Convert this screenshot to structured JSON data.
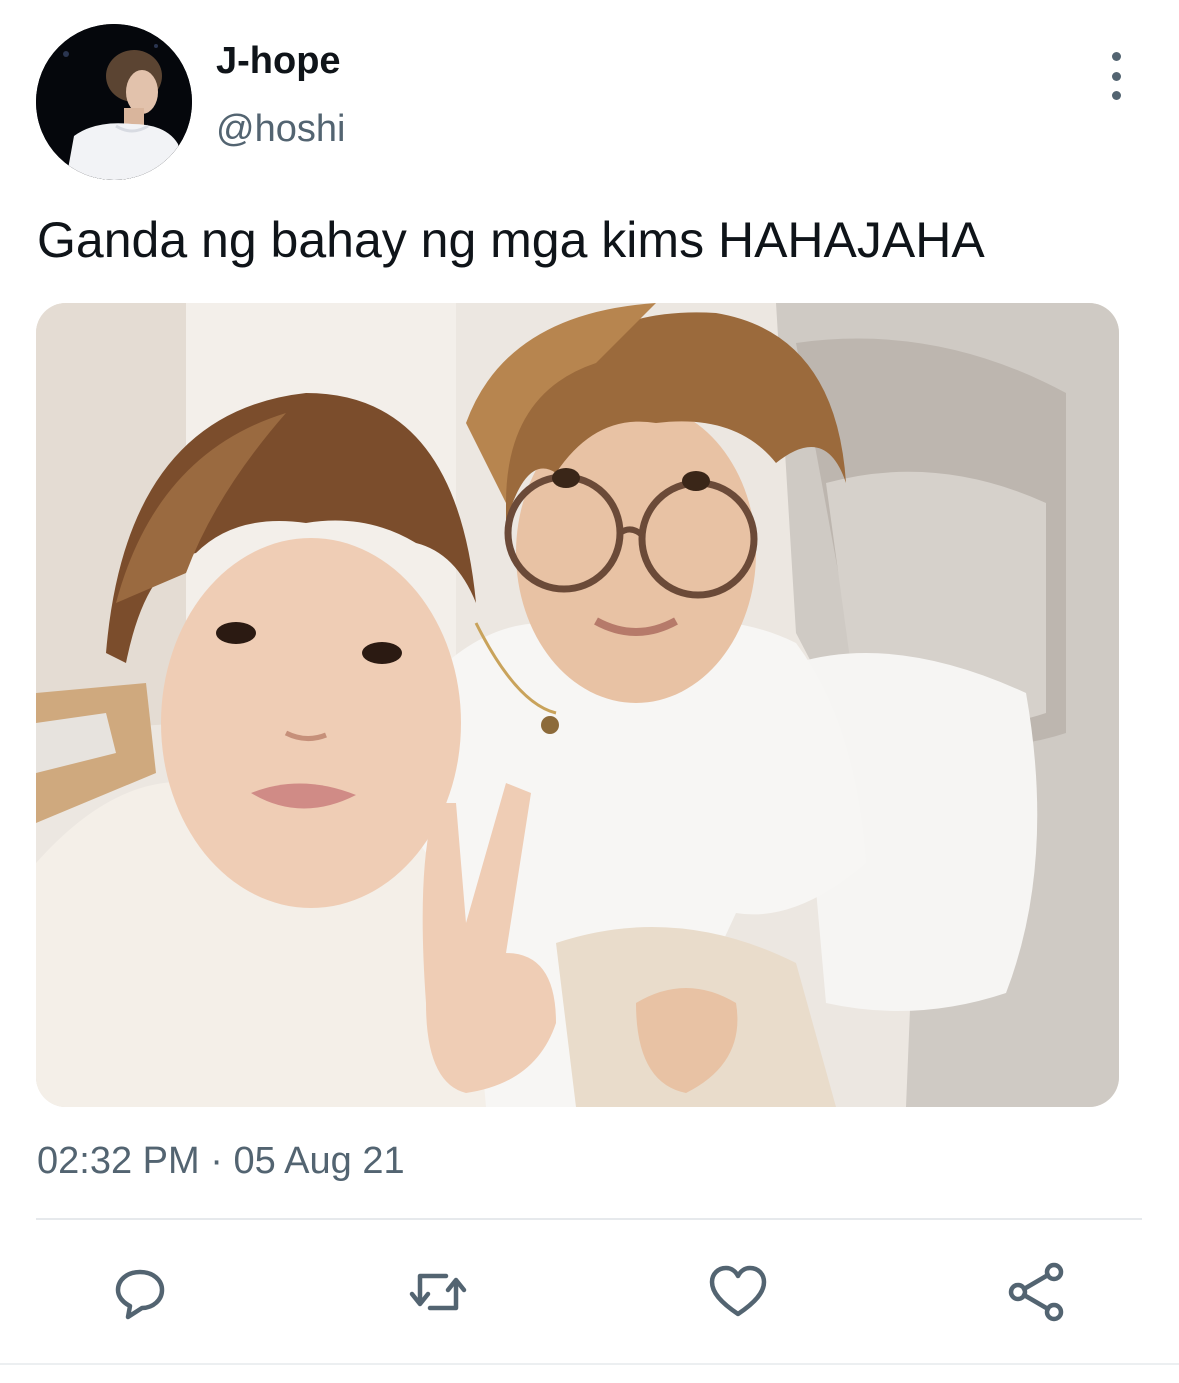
{
  "tweet": {
    "author_name": "J-hope",
    "author_handle": "@hoshi",
    "text": "Ganda ng bahay ng mga kims HAHAJAHA",
    "time": "02:32 PM",
    "separator": "·",
    "date": "05 Aug 21"
  },
  "icons": {
    "more": "more-vertical-icon",
    "reply": "reply-icon",
    "retweet": "retweet-icon",
    "like": "heart-icon",
    "share": "share-icon"
  },
  "colors": {
    "text_primary": "#0f1419",
    "text_secondary": "#536471",
    "icon": "#536471",
    "divider": "#e6e9ec"
  }
}
